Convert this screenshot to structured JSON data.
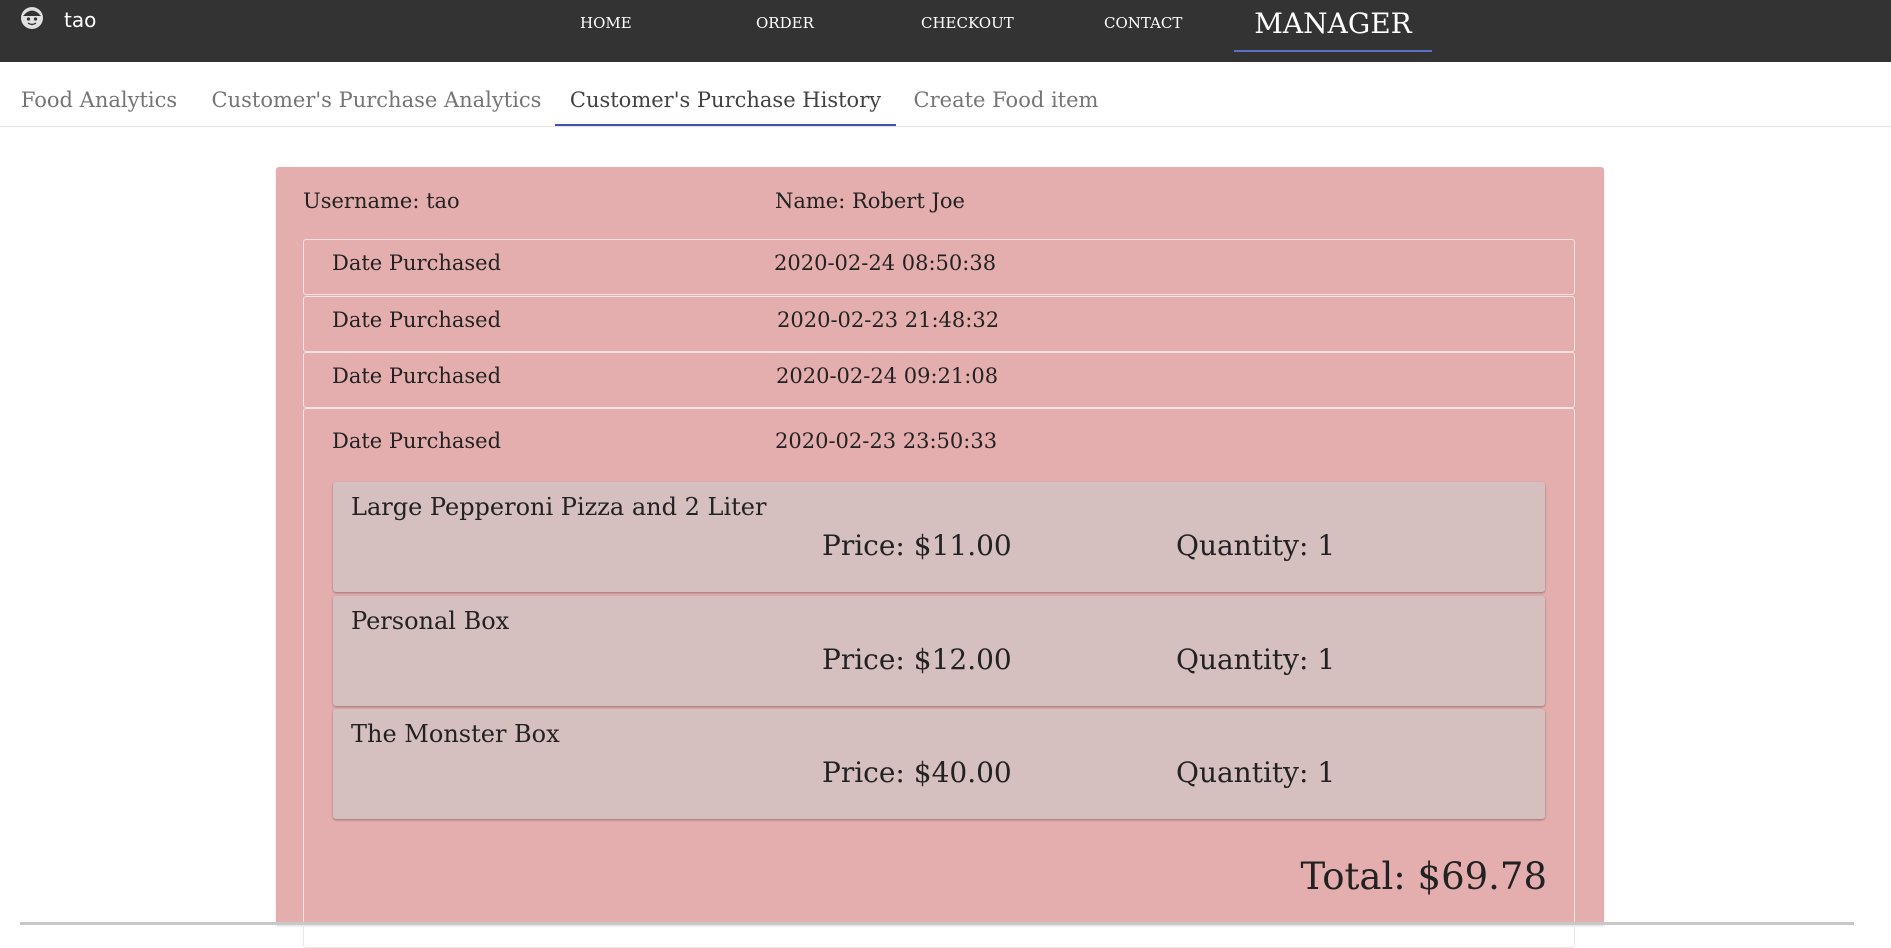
{
  "navbar": {
    "avatar_icon": "smiley-face-icon",
    "username": "tao",
    "links": [
      "Home",
      "Order",
      "Checkout",
      "Contact"
    ],
    "active": "MANAGER"
  },
  "tabs": [
    {
      "label": "Food Analytics",
      "active": false
    },
    {
      "label": "Customer's Purchase Analytics",
      "active": false
    },
    {
      "label": "Customer's Purchase History",
      "active": true
    },
    {
      "label": "Create Food item",
      "active": false
    }
  ],
  "customer": {
    "username_text": "Username: tao",
    "name_text": "Name: Robert Joe"
  },
  "purchases": [
    {
      "label": "Date Purchased",
      "date": "2020-02-24 08:50:38"
    },
    {
      "label": "Date Purchased",
      "date": "2020-02-23 21:48:32"
    },
    {
      "label": "Date Purchased",
      "date": "2020-02-24 09:21:08"
    },
    {
      "label": "Date Purchased",
      "date": "2020-02-23 23:50:33",
      "expanded": true,
      "items": [
        {
          "name": "Large Pepperoni Pizza and 2 Liter",
          "price": "Price: $11.00",
          "quantity": "Quantity: 1"
        },
        {
          "name": "Personal Box",
          "price": "Price: $12.00",
          "quantity": "Quantity: 1"
        },
        {
          "name": "The Monster Box",
          "price": "Price: $40.00",
          "quantity": "Quantity: 1"
        }
      ],
      "total": "Total: $69.78"
    }
  ],
  "colors": {
    "navbar_bg": "#333333",
    "card_bg": "#e5aeae",
    "item_bg": "#d6bfbf",
    "tab_indicator": "#3f51b5"
  }
}
